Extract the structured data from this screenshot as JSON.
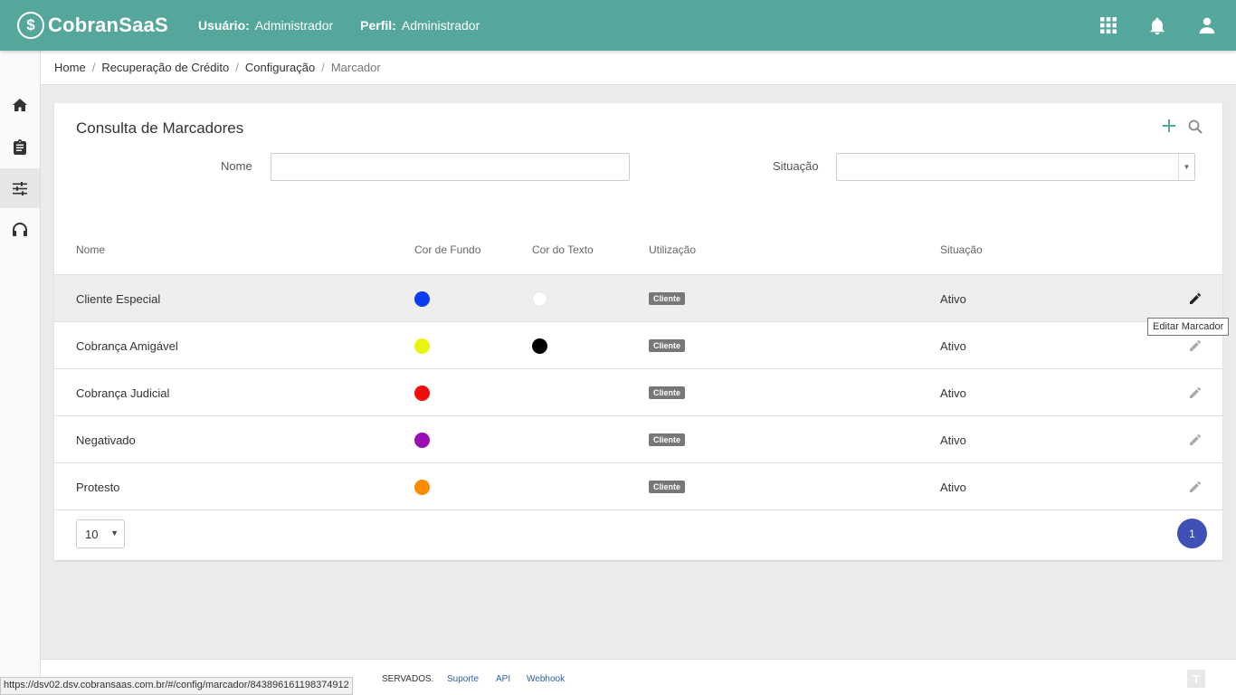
{
  "app": {
    "brand": "CobranSaaS",
    "logo_mark": "$"
  },
  "header": {
    "user_label": "Usuário:",
    "user_value": "Administrador",
    "profile_label": "Perfil:",
    "profile_value": "Administrador",
    "icons": [
      "apps-grid-icon",
      "bell-icon",
      "user-icon"
    ]
  },
  "sidebar": {
    "items": [
      "home-icon",
      "clipboard-icon",
      "sliders-icon",
      "headset-icon"
    ],
    "active_index": 2
  },
  "breadcrumb": {
    "items": [
      "Home",
      "Recuperação de Crédito",
      "Configuração"
    ],
    "current": "Marcador",
    "separator": "/"
  },
  "card": {
    "title": "Consulta de Marcadores",
    "filters": {
      "nome_label": "Nome",
      "nome_value": "",
      "situacao_label": "Situação",
      "situacao_value": ""
    }
  },
  "table": {
    "columns": [
      "Nome",
      "Cor de Fundo",
      "Cor do Texto",
      "Utilização",
      "Situação"
    ],
    "rows": [
      {
        "nome": "Cliente Especial",
        "bg": "#0d3df2",
        "fg": "#ffffff",
        "utilizacao": "Cliente",
        "situacao": "Ativo"
      },
      {
        "nome": "Cobrança Amigável",
        "bg": "#e8f50c",
        "fg": "#000000",
        "utilizacao": "Cliente",
        "situacao": "Ativo"
      },
      {
        "nome": "Cobrança Judicial",
        "bg": "#f20c0c",
        "fg": "",
        "utilizacao": "Cliente",
        "situacao": "Ativo"
      },
      {
        "nome": "Negativado",
        "bg": "#9a0fb3",
        "fg": "",
        "utilizacao": "Cliente",
        "situacao": "Ativo"
      },
      {
        "nome": "Protesto",
        "bg": "#ff8c00",
        "fg": "",
        "utilizacao": "Cliente",
        "situacao": "Ativo"
      }
    ]
  },
  "tooltip": "Editar Marcador",
  "pagination": {
    "page_size": "10",
    "current_page": "1"
  },
  "footer": {
    "copyright_fragment": "SERVADOS.",
    "links": [
      "Suporte",
      "API",
      "Webhook"
    ]
  },
  "status_url": "https://dsv02.dsv.cobransaas.com.br/#/config/marcador/843896161198374912",
  "colors": {
    "header": "#55a79b",
    "accent": "#3f51b5",
    "badge": "#777777"
  }
}
